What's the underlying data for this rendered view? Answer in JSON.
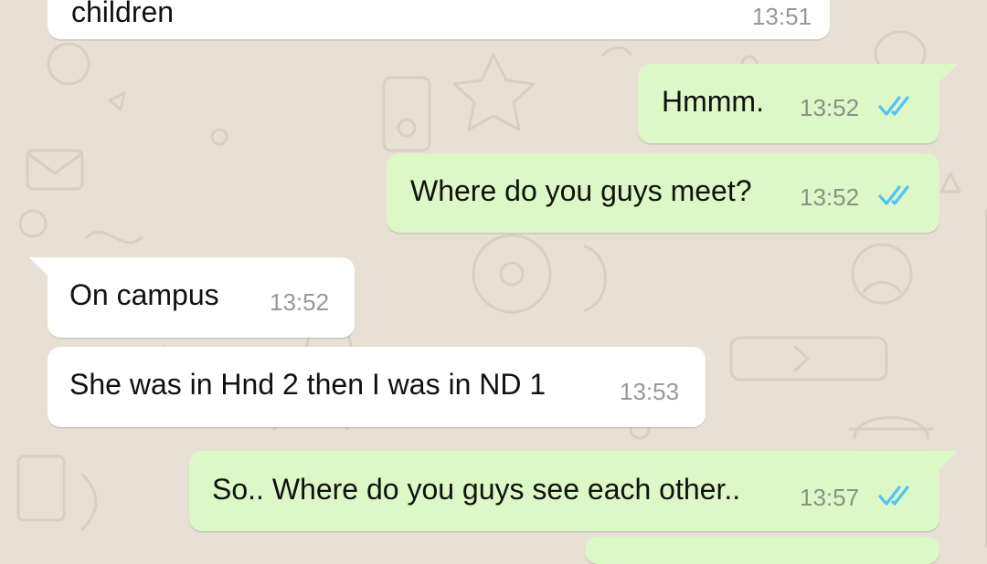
{
  "messages": [
    {
      "direction": "in",
      "text": "children",
      "time": "13:51"
    },
    {
      "direction": "out",
      "text": "Hmmm.",
      "time": "13:52",
      "status": "read"
    },
    {
      "direction": "out",
      "text": "Where do you guys meet?",
      "time": "13:52",
      "status": "read"
    },
    {
      "direction": "in",
      "text": "On campus",
      "time": "13:52"
    },
    {
      "direction": "in",
      "text": "She was in Hnd 2 then I was in ND 1",
      "time": "13:53"
    },
    {
      "direction": "out",
      "text": "So.. Where do you guys see each other..",
      "time": "13:57",
      "status": "read"
    }
  ],
  "colors": {
    "incoming_bubble": "#ffffff",
    "outgoing_bubble": "#dcf8c6",
    "read_ticks": "#4fc3f7",
    "wallpaper": "#e8e0d5"
  },
  "icons": {
    "read_status": "double-check-icon"
  }
}
